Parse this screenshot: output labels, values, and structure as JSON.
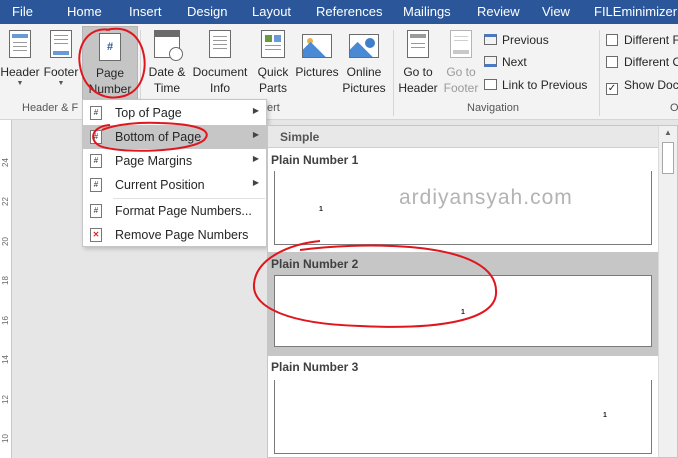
{
  "ribbon_tabs": [
    "File",
    "Home",
    "Insert",
    "Design",
    "Layout",
    "References",
    "Mailings",
    "Review",
    "View",
    "FILEminimizer"
  ],
  "header_footer_group": {
    "header_label": "Header",
    "footer_label": "Footer",
    "page_number_label_1": "Page",
    "page_number_label_2": "Number",
    "group_label": "Header & F"
  },
  "insert_group": {
    "date_time_1": "Date &",
    "date_time_2": "Time",
    "doc_info_1": "Document",
    "doc_info_2": "Info",
    "quick_parts_1": "Quick",
    "quick_parts_2": "Parts",
    "pictures": "Pictures",
    "online_pictures_1": "Online",
    "online_pictures_2": "Pictures",
    "group_label_tail": "ert"
  },
  "navigation_group": {
    "goto_header_1": "Go to",
    "goto_header_2": "Header",
    "goto_footer_1": "Go to",
    "goto_footer_2": "Footer",
    "previous": "Previous",
    "next": "Next",
    "link_to_previous": "Link to Previous",
    "group_label": "Navigation"
  },
  "options_group": {
    "different_first": "Different F",
    "different_odd": "Different O",
    "show_doc": "Show Doc",
    "show_doc_checked": true,
    "group_label": "O"
  },
  "page_number_menu": {
    "items": [
      {
        "label": "Top of Page",
        "has_submenu": true
      },
      {
        "label": "Bottom of Page",
        "has_submenu": true,
        "highlighted": true
      },
      {
        "label": "Page Margins",
        "has_submenu": true
      },
      {
        "label": "Current Position",
        "has_submenu": true
      },
      {
        "label": "Format Page Numbers...",
        "has_submenu": false
      },
      {
        "label": "Remove Page Numbers",
        "has_submenu": false
      }
    ]
  },
  "gallery": {
    "section_header": "Simple",
    "items": [
      {
        "title": "Plain Number 1",
        "number": "1"
      },
      {
        "title": "Plain Number 2",
        "number": "1"
      },
      {
        "title": "Plain Number 3",
        "number": "1"
      }
    ]
  },
  "ruler_numbers": [
    "24",
    "22",
    "20",
    "18",
    "16",
    "14",
    "12",
    "10"
  ],
  "watermark": "ardiyansyah.com",
  "colors": {
    "tabbar": "#2b579a",
    "ribbon": "#f3f3f3",
    "highlight": "#c6c6c6",
    "annotation": "#e0161e"
  }
}
